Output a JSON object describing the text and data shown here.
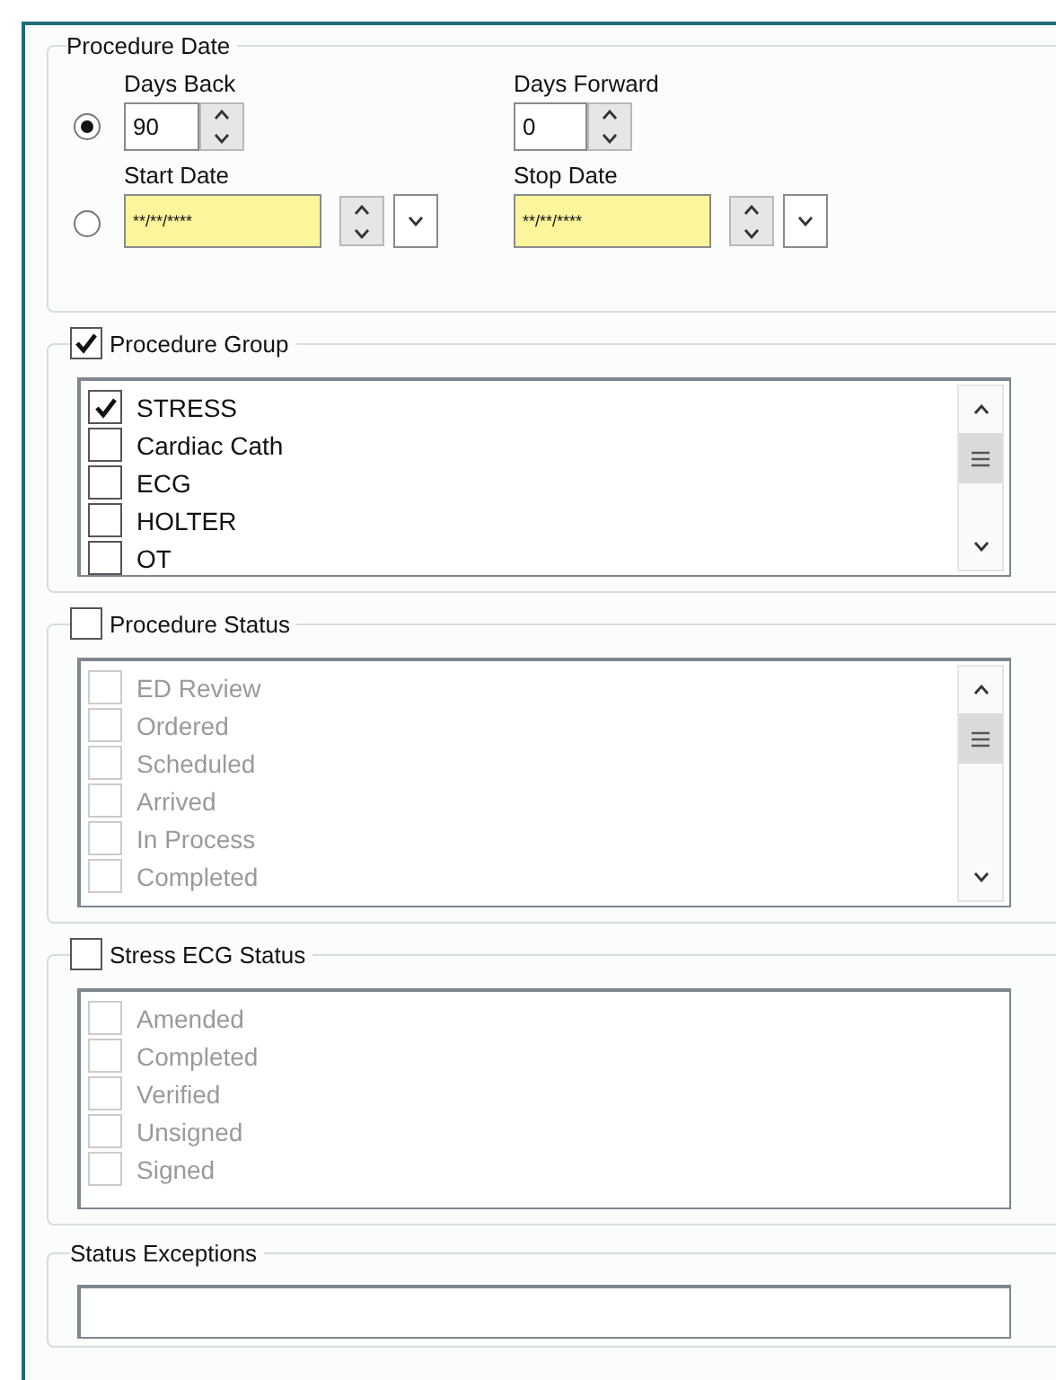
{
  "procedure_date": {
    "title": "Procedure Date",
    "options": [
      {
        "kind": "days",
        "selected": true,
        "fields": [
          {
            "label": "Days Back",
            "value": "90"
          },
          {
            "label": "Days Forward",
            "value": "0"
          }
        ]
      },
      {
        "kind": "dates",
        "selected": false,
        "fields": [
          {
            "label": "Start Date",
            "value": "**/**/****"
          },
          {
            "label": "Stop Date",
            "value": "**/**/****"
          }
        ]
      }
    ]
  },
  "groups": [
    {
      "kind": "checklist",
      "title": "Procedure Group",
      "checked": true,
      "disabled": false,
      "scrollable": true,
      "items": [
        {
          "label": "STRESS",
          "checked": true
        },
        {
          "label": "Cardiac Cath",
          "checked": false
        },
        {
          "label": "ECG",
          "checked": false
        },
        {
          "label": "HOLTER",
          "checked": false
        },
        {
          "label": "OT",
          "checked": false
        }
      ]
    },
    {
      "kind": "checklist",
      "title": "Procedure Status",
      "checked": false,
      "disabled": true,
      "scrollable": true,
      "items": [
        {
          "label": "ED Review",
          "checked": false
        },
        {
          "label": "Ordered",
          "checked": false
        },
        {
          "label": "Scheduled",
          "checked": false
        },
        {
          "label": "Arrived",
          "checked": false
        },
        {
          "label": "In Process",
          "checked": false
        },
        {
          "label": "Completed",
          "checked": false
        }
      ]
    },
    {
      "kind": "checklist",
      "title": "Stress ECG Status",
      "checked": false,
      "disabled": true,
      "scrollable": false,
      "items": [
        {
          "label": "Amended",
          "checked": false
        },
        {
          "label": "Completed",
          "checked": false
        },
        {
          "label": "Verified",
          "checked": false
        },
        {
          "label": "Unsigned",
          "checked": false
        },
        {
          "label": "Signed",
          "checked": false
        }
      ]
    },
    {
      "kind": "plain",
      "title": "Status Exceptions"
    }
  ]
}
